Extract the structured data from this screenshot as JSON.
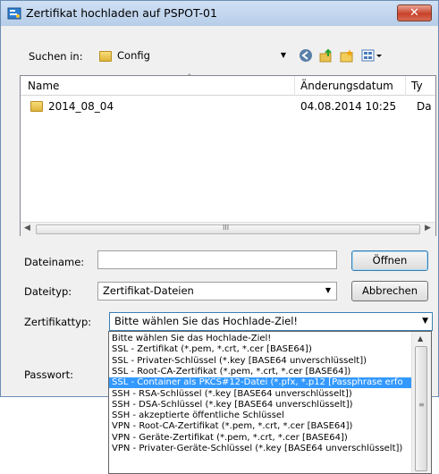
{
  "window": {
    "title": "Zertifikat hochladen auf PSPOT-01",
    "close_glyph": "✕"
  },
  "lookin": {
    "label": "Suchen in:",
    "value": "Config"
  },
  "filelist": {
    "columns": [
      "Name",
      "Änderungsdatum",
      "Ty"
    ],
    "rows": [
      {
        "name": "2014_08_04",
        "date": "04.08.2014 10:25",
        "type": "Da"
      }
    ]
  },
  "filename": {
    "label": "Dateiname:",
    "value": ""
  },
  "filetype": {
    "label": "Dateityp:",
    "value": "Zertifikat-Dateien"
  },
  "buttons": {
    "open": "Öffnen",
    "cancel": "Abbrechen"
  },
  "certtype": {
    "label": "Zertifikattyp:",
    "value": "Bitte wählen Sie das Hochlade-Ziel!"
  },
  "password": {
    "label": "Passwort:"
  },
  "dropdown": {
    "options": [
      "Bitte wählen Sie das Hochlade-Ziel!",
      "SSL - Zertifikat (*.pem, *.crt, *.cer [BASE64])",
      "SSL - Privater-Schlüssel (*.key [BASE64 unverschlüsselt])",
      "SSL - Root-CA-Zertifikat (*.pem, *.crt, *.cer [BASE64])",
      "SSL - Container als PKCS#12-Datei (*.pfx, *.p12 [Passphrase erfo",
      "SSH - RSA-Schlüssel (*.key [BASE64 unverschlüsselt])",
      "SSH - DSA-Schlüssel (*.key [BASE64 unverschlüsselt])",
      "SSH - akzeptierte öffentliche Schlüssel",
      "VPN - Root-CA-Zertifikat (*.pem, *.crt, *.cer [BASE64])",
      "VPN - Geräte-Zertifikat (*.pem, *.crt, *.cer [BASE64])",
      "VPN - Privater-Geräte-Schlüssel (*.key [BASE64 unverschlüsselt])"
    ],
    "selected_index": 4
  },
  "colors": {
    "selection": "#3399ff",
    "titlebar": "#c3d7ef",
    "close": "#c8412a"
  }
}
